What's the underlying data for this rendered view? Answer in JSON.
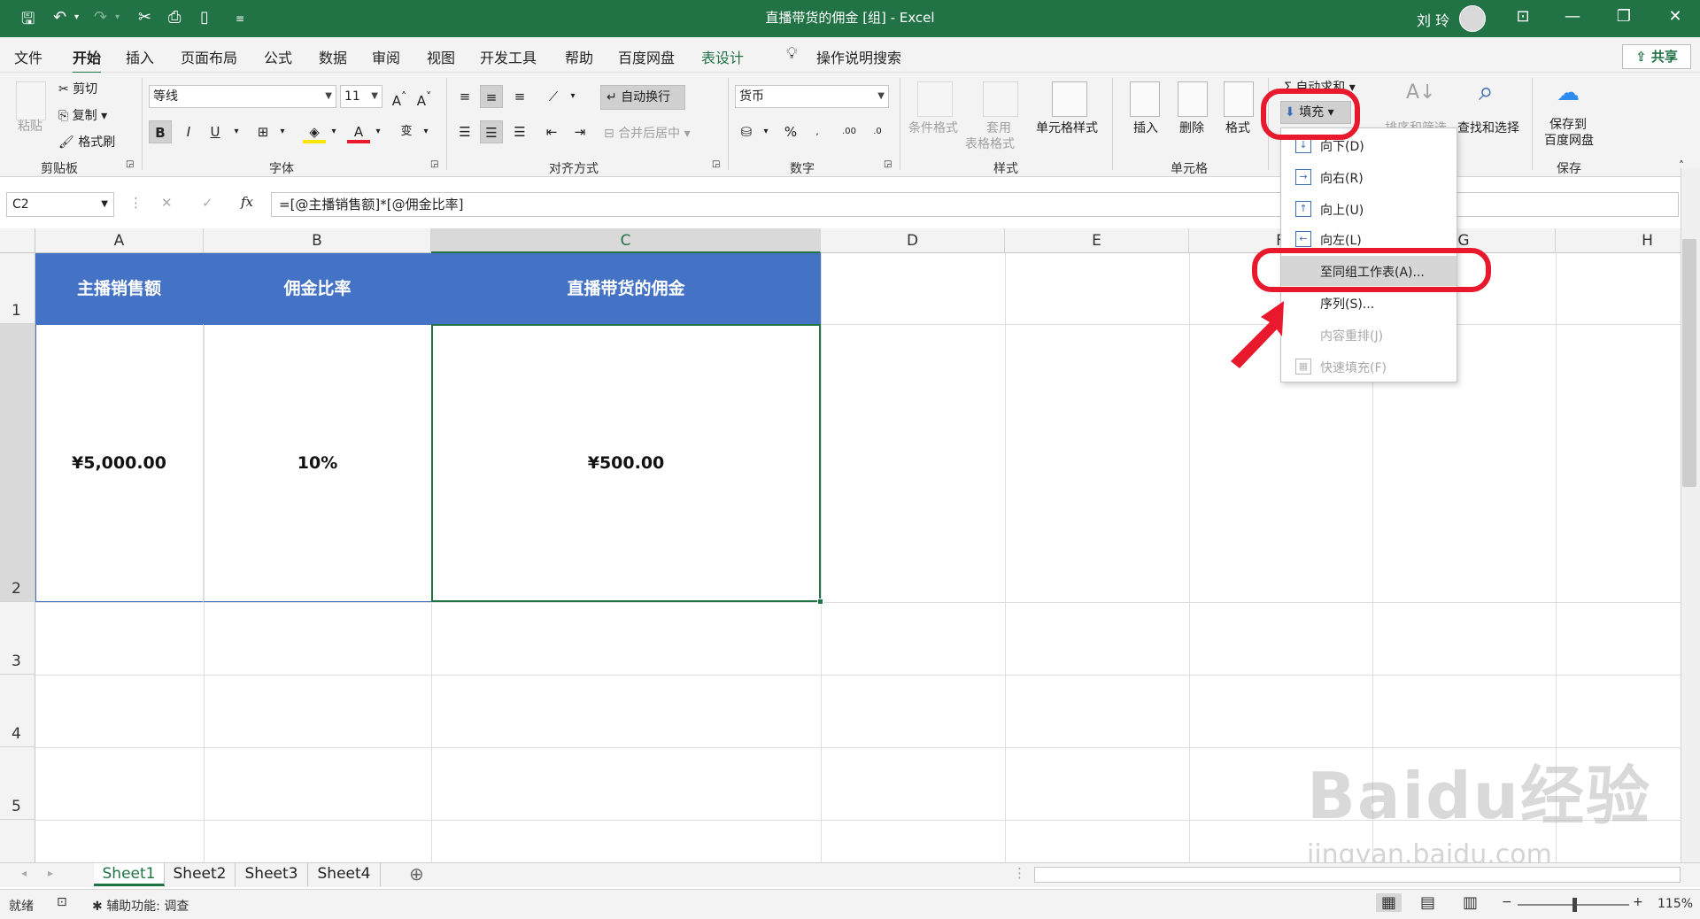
{
  "window": {
    "title": "直播带货的佣金  [组]  -  Excel",
    "user": "刘 玲",
    "accent": "#217346"
  },
  "quick_access": [
    "save-icon",
    "undo-icon",
    "redo-icon",
    "cut-icon",
    "save-as-icon",
    "new-icon",
    "customize-icon"
  ],
  "menu_tabs": [
    "文件",
    "开始",
    "插入",
    "页面布局",
    "公式",
    "数据",
    "审阅",
    "视图",
    "开发工具",
    "帮助",
    "百度网盘",
    "表设计"
  ],
  "active_tab": "开始",
  "tell_me": "操作说明搜索",
  "share": "共享",
  "ribbon": {
    "clipboard": {
      "label": "剪贴板",
      "paste": "粘贴",
      "cut": "剪切",
      "copy": "复制",
      "format_painter": "格式刷"
    },
    "font": {
      "label": "字体",
      "font_name": "等线",
      "font_size": "11",
      "bold": "B",
      "italic": "I",
      "underline": "U",
      "phonetic": "变"
    },
    "alignment": {
      "label": "对齐方式",
      "wrap_text": "自动换行",
      "merge": "合并后居中"
    },
    "number": {
      "label": "数字",
      "format": "货币",
      "percent": "%"
    },
    "styles": {
      "label": "样式",
      "conditional": "条件格式",
      "table_format_1": "套用",
      "table_format_2": "表格格式",
      "cell_styles": "单元格样式"
    },
    "cells": {
      "label": "单元格",
      "insert": "插入",
      "delete": "删除",
      "format": "格式"
    },
    "editing": {
      "autosum": "自动求和",
      "fill": "填充",
      "sort_filter": "排序和筛选",
      "find_select": "查找和选择"
    },
    "save": {
      "label": "保存",
      "save_to_1": "保存到",
      "save_to_2": "百度网盘"
    }
  },
  "formula_bar": {
    "name_box": "C2",
    "cancel": "✕",
    "enter": "✓",
    "fx": "fx",
    "formula": "=[@主播销售额]*[@佣金比率]"
  },
  "columns": [
    "A",
    "B",
    "C",
    "D",
    "E",
    "F",
    "G",
    "H"
  ],
  "rows": [
    "1",
    "2",
    "3",
    "4",
    "5"
  ],
  "table": {
    "headers": [
      "主播销售额",
      "佣金比率",
      "直播带货的佣金"
    ],
    "values": [
      "¥5,000.00",
      "10%",
      "¥500.00"
    ],
    "header_color": "#4472c4"
  },
  "fill_menu": [
    {
      "label": "向下(D)",
      "icon": "arrow-down-icon",
      "enabled": true
    },
    {
      "label": "向右(R)",
      "icon": "arrow-right-icon",
      "enabled": true
    },
    {
      "label": "向上(U)",
      "icon": "arrow-up-icon",
      "enabled": true
    },
    {
      "label": "向左(L)",
      "icon": "arrow-left-icon",
      "enabled": true
    },
    {
      "label": "至同组工作表(A)...",
      "icon": "",
      "enabled": true,
      "highlighted": true
    },
    {
      "label": "序列(S)...",
      "icon": "",
      "enabled": true
    },
    {
      "label": "内容重排(J)",
      "icon": "",
      "enabled": false
    },
    {
      "label": "快速填充(F)",
      "icon": "flash-fill-icon",
      "enabled": false
    }
  ],
  "sheets": [
    "Sheet1",
    "Sheet2",
    "Sheet3",
    "Sheet4"
  ],
  "active_sheet": "Sheet1",
  "status": {
    "ready": "就绪",
    "accessibility": "辅助功能: 调查",
    "zoom": "115%"
  },
  "watermark": {
    "brand": "Baidu经验",
    "url": "jingyan.baidu.com"
  },
  "annotation_color": "#e8192c"
}
